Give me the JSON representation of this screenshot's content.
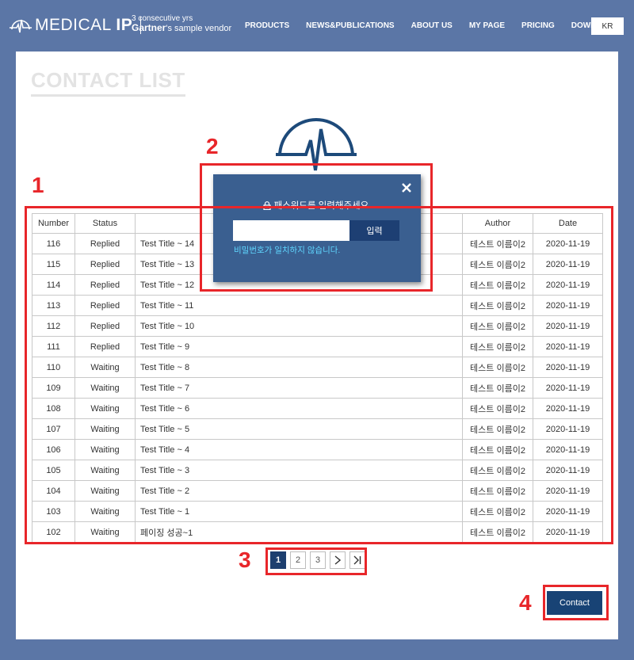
{
  "header": {
    "logo_medical": "MEDICAL",
    "logo_ip": "IP",
    "tagline_line1": "3 consecutive yrs",
    "tagline_brand": "Gartner",
    "tagline_rest": "'s sample vendor",
    "nav": [
      "PRODUCTS",
      "NEWS&PUBLICATIONS",
      "ABOUT US",
      "MY PAGE",
      "PRICING",
      "DOWNLOAD"
    ],
    "lang_button": "KR"
  },
  "page": {
    "title": "CONTACT LIST"
  },
  "table": {
    "columns": [
      "Number",
      "Status",
      "",
      "Author",
      "Date"
    ],
    "rows": [
      {
        "number": "116",
        "status": "Replied",
        "title": "Test Title ~ 14",
        "author": "테스트 이름이2",
        "date": "2020-11-19"
      },
      {
        "number": "115",
        "status": "Replied",
        "title": "Test Title ~ 13",
        "author": "테스트 이름이2",
        "date": "2020-11-19"
      },
      {
        "number": "114",
        "status": "Replied",
        "title": "Test Title ~ 12",
        "author": "테스트 이름이2",
        "date": "2020-11-19"
      },
      {
        "number": "113",
        "status": "Replied",
        "title": "Test Title ~ 11",
        "author": "테스트 이름이2",
        "date": "2020-11-19"
      },
      {
        "number": "112",
        "status": "Replied",
        "title": "Test Title ~ 10",
        "author": "테스트 이름이2",
        "date": "2020-11-19"
      },
      {
        "number": "111",
        "status": "Replied",
        "title": "Test Title ~ 9",
        "author": "테스트 이름이2",
        "date": "2020-11-19"
      },
      {
        "number": "110",
        "status": "Waiting",
        "title": "Test Title ~ 8",
        "author": "테스트 이름이2",
        "date": "2020-11-19"
      },
      {
        "number": "109",
        "status": "Waiting",
        "title": "Test Title ~ 7",
        "author": "테스트 이름이2",
        "date": "2020-11-19"
      },
      {
        "number": "108",
        "status": "Waiting",
        "title": "Test Title ~ 6",
        "author": "테스트 이름이2",
        "date": "2020-11-19"
      },
      {
        "number": "107",
        "status": "Waiting",
        "title": "Test Title ~ 5",
        "author": "테스트 이름이2",
        "date": "2020-11-19"
      },
      {
        "number": "106",
        "status": "Waiting",
        "title": "Test Title ~ 4",
        "author": "테스트 이름이2",
        "date": "2020-11-19"
      },
      {
        "number": "105",
        "status": "Waiting",
        "title": "Test Title ~ 3",
        "author": "테스트 이름이2",
        "date": "2020-11-19"
      },
      {
        "number": "104",
        "status": "Waiting",
        "title": "Test Title ~ 2",
        "author": "테스트 이름이2",
        "date": "2020-11-19"
      },
      {
        "number": "103",
        "status": "Waiting",
        "title": "Test Title ~ 1",
        "author": "테스트 이름이2",
        "date": "2020-11-19"
      },
      {
        "number": "102",
        "status": "Waiting",
        "title": "페이징 성공~1",
        "author": "테스트 이름이2",
        "date": "2020-11-19"
      }
    ]
  },
  "pagination": {
    "pages": [
      "1",
      "2",
      "3"
    ],
    "current": "1"
  },
  "contact_button": "Contact",
  "modal": {
    "message": "패스워드를 입력해주세요.",
    "submit_label": "입력",
    "input_value": "",
    "error": "비밀번호가 일치하지 않습니다."
  },
  "annotations": [
    "1",
    "2",
    "3",
    "4"
  ],
  "colors": {
    "background": "#5b76a6",
    "modal": "#3a5f90",
    "primary_button": "#184375",
    "annotation": "#e8262a",
    "error_text": "#5fd7ff"
  }
}
